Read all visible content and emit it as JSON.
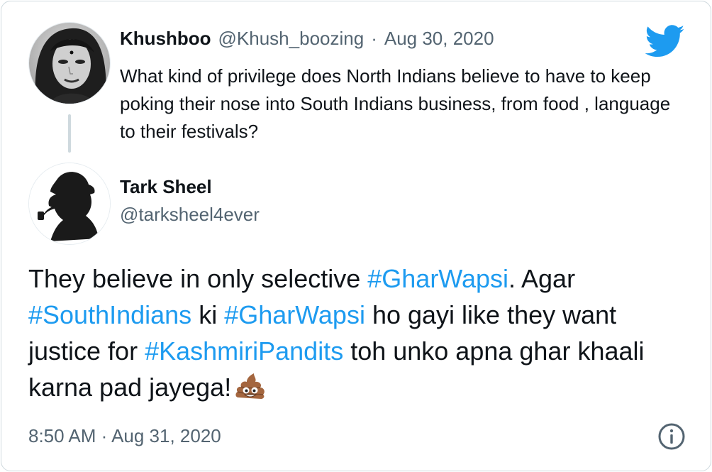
{
  "reply": {
    "name": "Khushboo",
    "handle": "@Khush_boozing",
    "separator": "·",
    "date": "Aug 30, 2020",
    "text": "What kind of privilege does North Indians believe to have to keep poking their nose into South Indians business, from food , language to their festivals?",
    "avatar_icon": "woman-portrait-avatar"
  },
  "tweet": {
    "name": "Tark Sheel",
    "handle": "@tarksheel4ever",
    "avatar_icon": "sherlock-silhouette-avatar",
    "segments": [
      {
        "text": "They believe in only selective ",
        "hashtag": false
      },
      {
        "text": "#GharWapsi",
        "hashtag": true
      },
      {
        "text": ". Agar ",
        "hashtag": false
      },
      {
        "text": "#SouthIndians",
        "hashtag": true
      },
      {
        "text": " ki ",
        "hashtag": false
      },
      {
        "text": "#GharWapsi",
        "hashtag": true
      },
      {
        "text": " ho gayi like they want justice for ",
        "hashtag": false
      },
      {
        "text": "#KashmiriPandits",
        "hashtag": true
      },
      {
        "text": " toh unko apna ghar khaali karna pad jayega!",
        "hashtag": false
      }
    ],
    "emoji": "pile-of-poo-emoji",
    "timestamp": "8:50 AM · Aug 31, 2020"
  },
  "icons": {
    "brand": "twitter-bird-icon",
    "info": "info-icon"
  },
  "colors": {
    "accent": "#1d9bf0",
    "text": "#0f1419",
    "muted": "#536471",
    "border": "#cfd9de"
  }
}
